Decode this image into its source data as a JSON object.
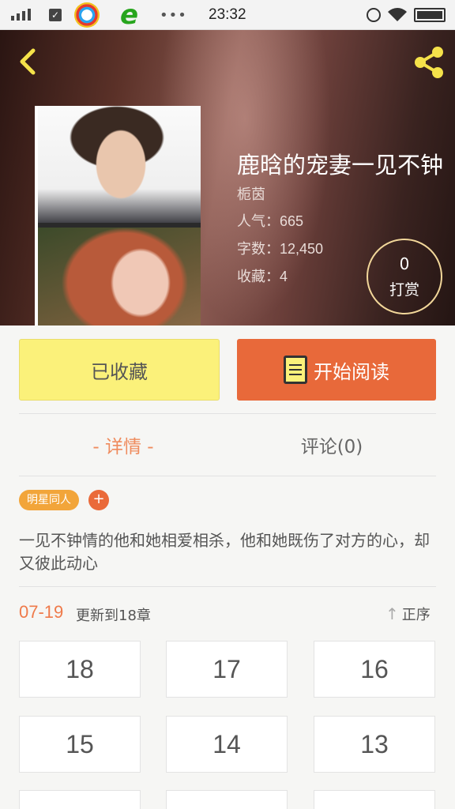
{
  "status_bar": {
    "time": "23:32",
    "icons": [
      "signal-icon",
      "checkbox-icon",
      "qq-browser-icon",
      "ie-browser-icon",
      "more-dots-icon",
      "alarm-icon",
      "wifi-icon",
      "battery-icon"
    ],
    "dots": "•••"
  },
  "book": {
    "title": "鹿晗的宠妻一见不钟",
    "author": "栀茵",
    "popularity": "人气：665",
    "word_count": "字数：12,450",
    "favorites": "收藏：4"
  },
  "tip": {
    "count": "0",
    "label": "打赏"
  },
  "actions": {
    "favorited_label": "已收藏",
    "start_reading_label": "开始阅读"
  },
  "tabs": {
    "detail": "- 详情 -",
    "comments": "评论(0)"
  },
  "tags": {
    "items": [
      "明星同人"
    ],
    "add": "+"
  },
  "description": "一见不钟情的他和她相爱相杀，他和她既伤了对方的心，却又彼此动心",
  "updates": {
    "date": "07-19",
    "text": "更新到18章",
    "order_label": "正序"
  },
  "chapters": [
    "18",
    "17",
    "16",
    "15",
    "14",
    "13"
  ],
  "colors": {
    "accent_orange": "#e8693a",
    "favorite_yellow": "#fbf17a",
    "tab_active": "#ef8b5d",
    "tag": "#f2a53a",
    "tip_ring": "#f2d79a"
  }
}
